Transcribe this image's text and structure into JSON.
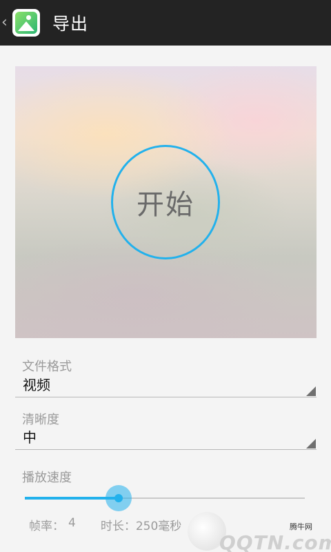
{
  "action_bar": {
    "back_icon": "‹",
    "app_icon": "gallery-landscape-icon",
    "title": "导出"
  },
  "preview": {
    "start_label": "开始",
    "ring_color": "#22b1ec"
  },
  "form": {
    "format": {
      "label": "文件格式",
      "value": "视频"
    },
    "clarity": {
      "label": "清晰度",
      "value": "中"
    },
    "speed": {
      "label": "播放速度",
      "level": 0.335
    }
  },
  "stats": {
    "fps_label": "帧率：",
    "fps_value": "4",
    "duration_label": "时长：",
    "duration_value": "250毫秒"
  },
  "watermark": {
    "site": "腾牛网",
    "brand": "QQTN.com"
  },
  "colors": {
    "accent": "#22b1ec",
    "action_bar": "#232323"
  }
}
